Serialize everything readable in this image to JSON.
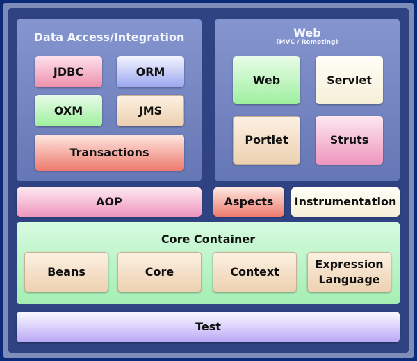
{
  "data_access": {
    "title": "Data Access/Integration",
    "modules": [
      "JDBC",
      "ORM",
      "OXM",
      "JMS",
      "Transactions"
    ]
  },
  "web": {
    "title": "Web",
    "subtitle": "(MVC / Remoting)",
    "modules": [
      "Web",
      "Servlet",
      "Portlet",
      "Struts"
    ]
  },
  "middle": {
    "aop": "AOP",
    "aspects": "Aspects",
    "instrumentation": "Instrumentation"
  },
  "core_container": {
    "title": "Core Container",
    "modules": [
      "Beans",
      "Core",
      "Context",
      "Expression Language"
    ]
  },
  "test": "Test"
}
